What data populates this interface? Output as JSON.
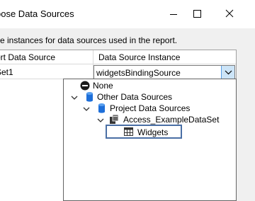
{
  "window": {
    "title": "oose Data Sources"
  },
  "instructions": "se instances for data sources used in the report.",
  "grid": {
    "columns": [
      "ort Data Source",
      "Data Source Instance"
    ],
    "rows": [
      {
        "data_source": "Set1",
        "instance": "widgetsBindingSource"
      }
    ]
  },
  "tree": {
    "none": "None",
    "other": "Other Data Sources",
    "project": "Project Data Sources",
    "dataset": "Access_ExampleDataSet",
    "table": "Widgets"
  },
  "colors": {
    "accent": "#569de5",
    "selection_border": "#4a6fa5",
    "db_icon": "#1e6fd9"
  },
  "icons": [
    "minimize-icon",
    "maximize-icon",
    "close-icon",
    "chevron-down-icon",
    "none-icon",
    "database-icon",
    "table-icon"
  ]
}
